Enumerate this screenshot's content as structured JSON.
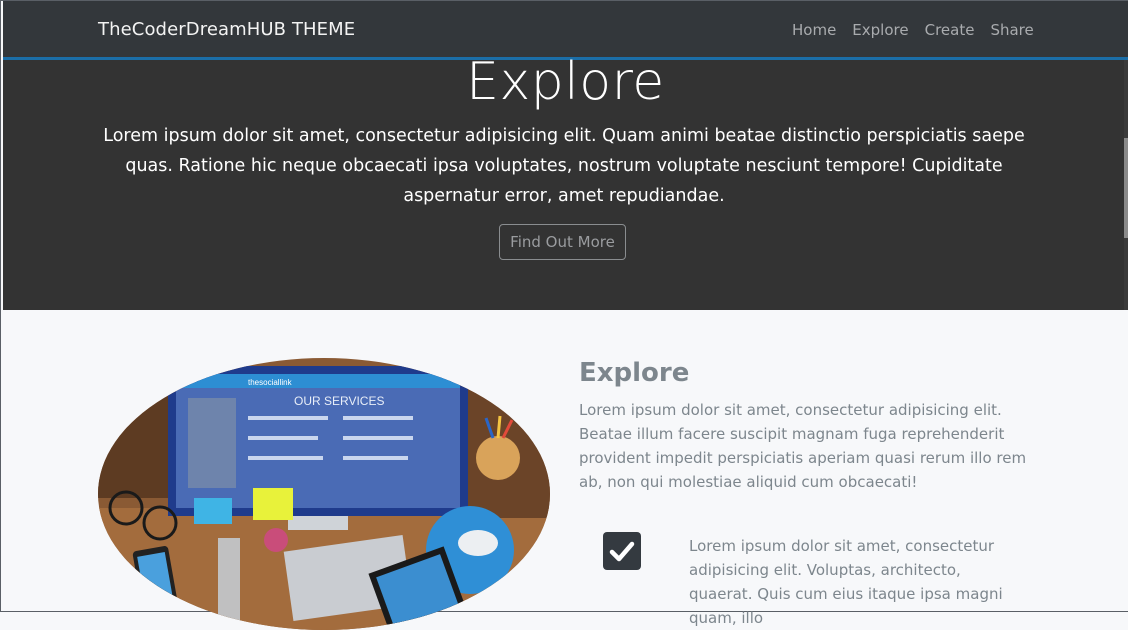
{
  "navbar": {
    "brand": "TheCoderDreamHUB THEME",
    "links": [
      "Home",
      "Explore",
      "Create",
      "Share"
    ]
  },
  "hero": {
    "title": "Explore",
    "text": "Lorem ipsum dolor sit amet, consectetur adipisicing elit. Quam animi beatae distinctio perspiciatis saepe quas. Ratione hic neque obcaecati ipsa voluptates, nostrum voluptate nesciunt tempore! Cupiditate aspernatur error, amet repudiandae.",
    "button": "Find Out More"
  },
  "section": {
    "title": "Explore",
    "text": "Lorem ipsum dolor sit amet, consectetur adipisicing elit. Beatae illum facere suscipit magnam fuga reprehenderit provident impedit perspiciatis aperiam quasi rerum illo rem ab, non qui molestiae aliquid cum obcaecati!",
    "image_text": {
      "site_name": "thesociallink",
      "heading": "OUR SERVICES"
    },
    "feature": {
      "icon": "check-icon",
      "text": "Lorem ipsum dolor sit amet, consectetur adipisicing elit. Voluptas, architecto, quaerat. Quis cum eius itaque ipsa magni quam, illo"
    }
  },
  "colors": {
    "navbar_bg": "#33373b",
    "navbar_accent": "#1b6ea8",
    "hero_bg": "#333333",
    "body_bg": "#f7f8fa",
    "muted_text": "#7d868d"
  }
}
